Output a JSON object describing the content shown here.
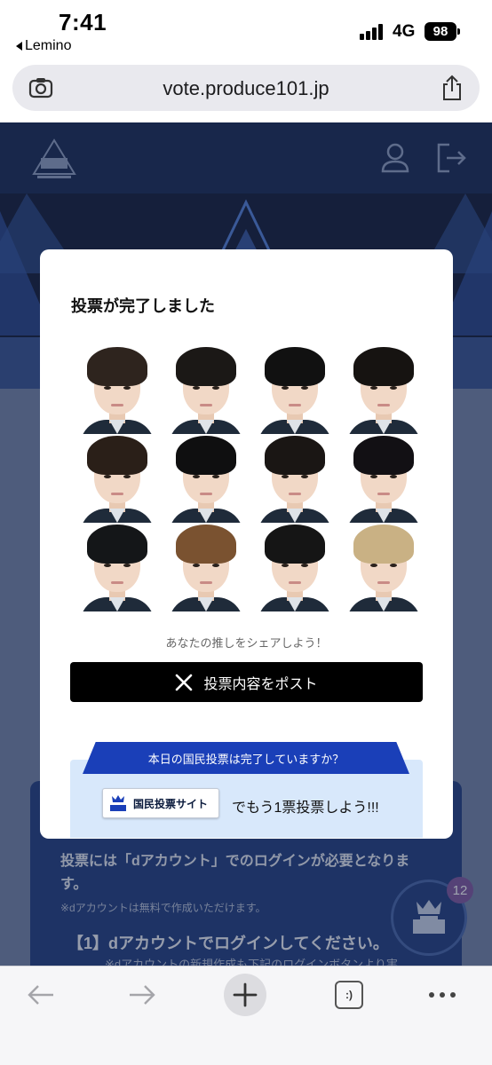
{
  "status_bar": {
    "time": "7:41",
    "back_app": "Lemino",
    "network": "4G",
    "battery": "98"
  },
  "browser": {
    "url": "vote.produce101.jp",
    "tabs_label": ":)"
  },
  "modal": {
    "title": "投票が完了しました",
    "share_caption": "あなたの推しをシェアしよう！",
    "post_button": "投票内容をポスト",
    "vote_question": "本日の国民投票は完了していますか？",
    "vote_site_badge": "国民投票サイト",
    "vote_cta": "でもう1票投票しよう!!!",
    "trainees": [
      {
        "hair": "#2e241e"
      },
      {
        "hair": "#1b1816"
      },
      {
        "hair": "#111111"
      },
      {
        "hair": "#161311"
      },
      {
        "hair": "#2a1f18"
      },
      {
        "hair": "#0f0f10"
      },
      {
        "hair": "#1a1614"
      },
      {
        "hair": "#121014"
      },
      {
        "hair": "#141618"
      },
      {
        "hair": "#7a5230"
      },
      {
        "hair": "#151515"
      },
      {
        "hair": "#c9b184"
      }
    ]
  },
  "page": {
    "login_text": "投票には「dアカウント」でのログインが必要となります。",
    "login_note": "※dアカウントは無料で作成いただけます。",
    "step_text": "【1】dアカウントでログインしてください。",
    "step_note": "※dアカウントの新規作成も下記のログインボタンより実",
    "fab_badge": "12"
  },
  "colors": {
    "header": "#0c1e4c",
    "vote_ribbon": "#1a3fb8",
    "vote_box": "#d8e8fb",
    "post_button": "#000000"
  }
}
